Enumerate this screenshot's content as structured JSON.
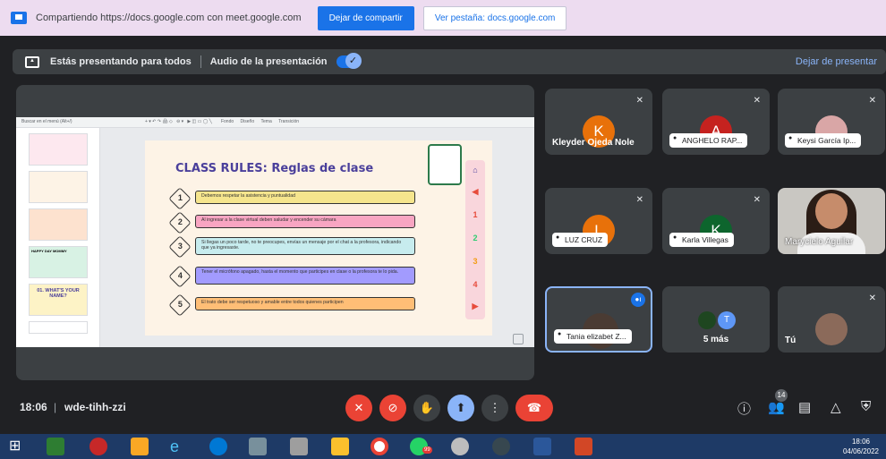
{
  "share_bar": {
    "message": "Compartiendo https://docs.google.com con meet.google.com",
    "stop_button": "Dejar de compartir",
    "view_tab_button": "Ver pestaña: docs.google.com"
  },
  "presenting_bar": {
    "status": "Estás presentando para todos",
    "audio_label": "Audio de la presentación",
    "stop_link": "Dejar de presentar"
  },
  "slides_app": {
    "menu_search": "Buscar en el menú (Alt+/)",
    "toolbar_items": [
      "Fondo",
      "Diseño",
      "Tema",
      "Transición"
    ],
    "zoom": "Ajustar"
  },
  "slide": {
    "title": "CLASS RULES: Reglas de clase",
    "rules": [
      {
        "num": "1",
        "text": "Debemos respetar la asistencia y puntualidad",
        "color": "#f6e58d"
      },
      {
        "num": "2",
        "text": "Al ingresar a la clase virtual deben saludar y encender su cámara",
        "color": "#f8a5c2"
      },
      {
        "num": "3",
        "text": "Si llegas un poco tarde, no te preocupes, envías un mensaje por el chat a la profesora, indicando que ya ingresaste.",
        "color": "#c7ecee"
      },
      {
        "num": "4",
        "text": "Tener el micrófono apagado, hasta el momento que participes en clase o la profesora te lo pida.",
        "color": "#a29bfe"
      },
      {
        "num": "5",
        "text": "El trato debe ser respetuoso y amable entre todos quienes participen",
        "color": "#ffbe76"
      }
    ],
    "side_numbers": [
      "1",
      "2",
      "3",
      "4"
    ]
  },
  "filmstrip": {
    "thumb_title": "01. WHAT'S YOUR NAME?",
    "thumb_happy": "HAPPY DAY MOMMY"
  },
  "participants": [
    {
      "name": "Kleyder Ojeda Nole",
      "initial": "K",
      "color": "#e8710a"
    },
    {
      "name": "ANGHELO RAP...",
      "initial": "A",
      "color": "#c5221f"
    },
    {
      "name": "Keysi García Ip...",
      "initial": "",
      "color": "#5f6368"
    },
    {
      "name": "LUZ CRUZ",
      "initial": "L",
      "color": "#e8710a"
    },
    {
      "name": "Karla Villegas",
      "initial": "K",
      "color": "#0d652d"
    },
    {
      "name": "Marycielo Aguilar",
      "initial": "",
      "color": "#5f6368"
    },
    {
      "name": "Tania elizabet Z...",
      "initial": "",
      "color": "#5f6368"
    },
    {
      "name": "5 más",
      "initial": "T",
      "color": "#5e97f6"
    },
    {
      "name": "Tú",
      "initial": "",
      "color": "#5f6368"
    }
  ],
  "meeting": {
    "time": "18:06",
    "separator": "|",
    "code": "wde-tihh-zzi",
    "participant_count": "14"
  },
  "taskbar": {
    "clock_time": "18:06",
    "clock_date": "04/06/2022",
    "whatsapp_badge": "99"
  }
}
